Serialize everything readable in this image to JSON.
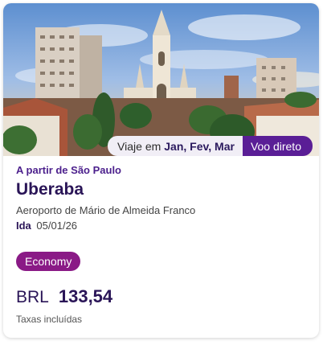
{
  "photo": {
    "subject": "Uberaba city skyline with cathedral"
  },
  "tags": {
    "months_prefix": "Viaje em",
    "months_value": "Jan, Fev, Mar",
    "direct_flight": "Voo direto"
  },
  "offer": {
    "origin": "A partir de São Paulo",
    "destination": "Uberaba",
    "airport": "Aeroporto de Mário de Almeida Franco",
    "ida_label": "Ida",
    "ida_date": "05/01/26",
    "cabin": "Economy",
    "currency": "BRL",
    "price": "133,54",
    "taxes_note": "Taxas incluídas"
  },
  "colors": {
    "brand_purple": "#5a1e96",
    "badge_magenta": "#8a1a86",
    "heading": "#2a1557"
  }
}
